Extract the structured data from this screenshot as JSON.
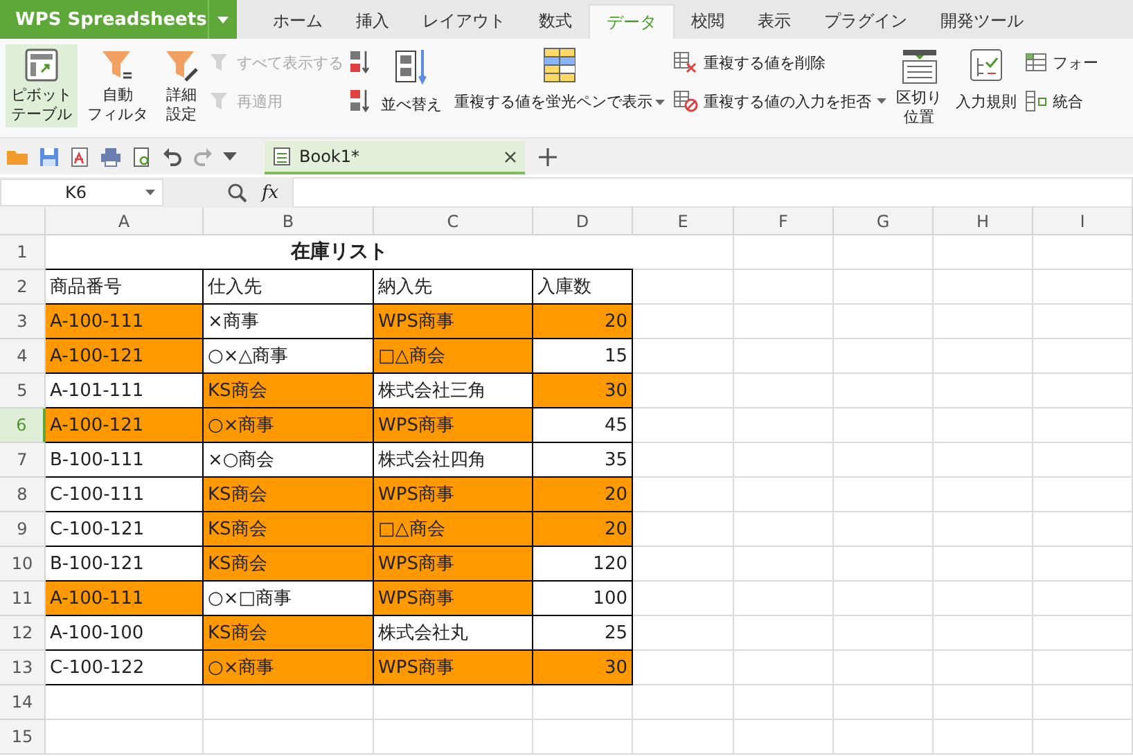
{
  "app": {
    "name": "WPS Spreadsheets"
  },
  "ribbon_tabs": [
    {
      "label": "ホーム",
      "selected": false
    },
    {
      "label": "挿入",
      "selected": false
    },
    {
      "label": "レイアウト",
      "selected": false
    },
    {
      "label": "数式",
      "selected": false
    },
    {
      "label": "データ",
      "selected": true
    },
    {
      "label": "校閲",
      "selected": false
    },
    {
      "label": "表示",
      "selected": false
    },
    {
      "label": "プラグイン",
      "selected": false
    },
    {
      "label": "開発ツール",
      "selected": false
    }
  ],
  "ribbon": [
    {
      "kind": "large",
      "lines": [
        "ピボット",
        "テーブル"
      ],
      "selected": true
    },
    {
      "kind": "large",
      "lines": [
        "自動",
        "フィルタ"
      ],
      "selected": false
    },
    {
      "kind": "large",
      "lines": [
        "詳細",
        "設定"
      ],
      "selected": false
    },
    {
      "kind": "stack",
      "items": [
        {
          "label": "すべて表示する",
          "disabled": true
        },
        {
          "label": "再適用",
          "disabled": true
        }
      ]
    },
    {
      "kind": "stack",
      "items": [
        {
          "disabled": false
        },
        {
          "disabled": false
        }
      ]
    },
    {
      "kind": "medium",
      "label": "並べ替え",
      "dropdown": false
    },
    {
      "kind": "medium",
      "label": "重複する値を蛍光ペンで表示",
      "dropdown": true
    },
    {
      "kind": "stack",
      "items": [
        {
          "label": "重複する値を削除",
          "disabled": false,
          "dropdown": false
        },
        {
          "label": "重複する値の入力を拒否",
          "disabled": false,
          "dropdown": true
        }
      ]
    },
    {
      "kind": "large",
      "lines": [
        "区切り",
        "位置"
      ],
      "selected": false
    },
    {
      "kind": "medium",
      "label": "入力規則",
      "dropdown": false
    },
    {
      "kind": "stack",
      "items": [
        {
          "label": "フォー",
          "disabled": false
        },
        {
          "label": "統合",
          "disabled": false
        }
      ]
    }
  ],
  "document_tabs": [
    {
      "title": "Book1*",
      "selected": true
    }
  ],
  "formula_bar": {
    "name_box": "K6",
    "fx": "fx"
  },
  "columns": [
    "A",
    "B",
    "C",
    "D",
    "E",
    "F",
    "G",
    "H",
    "I"
  ],
  "rows": [
    {
      "number": "1",
      "selected": false,
      "title": "在庫リスト"
    },
    {
      "number": "2",
      "selected": false,
      "cells": [
        {
          "text": "商品番号",
          "kind": "text",
          "highlighted": false
        },
        {
          "text": "仕入先",
          "kind": "text",
          "highlighted": false
        },
        {
          "text": "納入先",
          "kind": "text",
          "highlighted": false
        },
        {
          "text": "入庫数",
          "kind": "text",
          "highlighted": false
        }
      ]
    },
    {
      "number": "3",
      "selected": false,
      "cells": [
        {
          "text": "A-100-111",
          "kind": "text",
          "highlighted": true
        },
        {
          "text": "×商事",
          "kind": "text",
          "highlighted": false
        },
        {
          "text": "WPS商事",
          "kind": "text",
          "highlighted": true
        },
        {
          "text": "20",
          "kind": "number",
          "highlighted": true
        }
      ]
    },
    {
      "number": "4",
      "selected": false,
      "cells": [
        {
          "text": "A-100-121",
          "kind": "text",
          "highlighted": true
        },
        {
          "text": "○×△商事",
          "kind": "text",
          "highlighted": false
        },
        {
          "text": "□△商会",
          "kind": "text",
          "highlighted": true
        },
        {
          "text": "15",
          "kind": "number",
          "highlighted": false
        }
      ]
    },
    {
      "number": "5",
      "selected": false,
      "cells": [
        {
          "text": "A-101-111",
          "kind": "text",
          "highlighted": false
        },
        {
          "text": "KS商会",
          "kind": "text",
          "highlighted": true
        },
        {
          "text": "株式会社三角",
          "kind": "text",
          "highlighted": false
        },
        {
          "text": "30",
          "kind": "number",
          "highlighted": true
        }
      ]
    },
    {
      "number": "6",
      "selected": true,
      "cells": [
        {
          "text": "A-100-121",
          "kind": "text",
          "highlighted": true
        },
        {
          "text": "○×商事",
          "kind": "text",
          "highlighted": true
        },
        {
          "text": "WPS商事",
          "kind": "text",
          "highlighted": true
        },
        {
          "text": "45",
          "kind": "number",
          "highlighted": false
        }
      ]
    },
    {
      "number": "7",
      "selected": false,
      "cells": [
        {
          "text": "B-100-111",
          "kind": "text",
          "highlighted": false
        },
        {
          "text": "×○商会",
          "kind": "text",
          "highlighted": false
        },
        {
          "text": "株式会社四角",
          "kind": "text",
          "highlighted": false
        },
        {
          "text": "35",
          "kind": "number",
          "highlighted": false
        }
      ]
    },
    {
      "number": "8",
      "selected": false,
      "cells": [
        {
          "text": "C-100-111",
          "kind": "text",
          "highlighted": false
        },
        {
          "text": "KS商会",
          "kind": "text",
          "highlighted": true
        },
        {
          "text": "WPS商事",
          "kind": "text",
          "highlighted": true
        },
        {
          "text": "20",
          "kind": "number",
          "highlighted": true
        }
      ]
    },
    {
      "number": "9",
      "selected": false,
      "cells": [
        {
          "text": "C-100-121",
          "kind": "text",
          "highlighted": false
        },
        {
          "text": "KS商会",
          "kind": "text",
          "highlighted": true
        },
        {
          "text": "□△商会",
          "kind": "text",
          "highlighted": true
        },
        {
          "text": "20",
          "kind": "number",
          "highlighted": true
        }
      ]
    },
    {
      "number": "10",
      "selected": false,
      "cells": [
        {
          "text": "B-100-121",
          "kind": "text",
          "highlighted": false
        },
        {
          "text": "KS商会",
          "kind": "text",
          "highlighted": true
        },
        {
          "text": "WPS商事",
          "kind": "text",
          "highlighted": true
        },
        {
          "text": "120",
          "kind": "number",
          "highlighted": false
        }
      ]
    },
    {
      "number": "11",
      "selected": false,
      "cells": [
        {
          "text": "A-100-111",
          "kind": "text",
          "highlighted": true
        },
        {
          "text": "○×□商事",
          "kind": "text",
          "highlighted": false
        },
        {
          "text": "WPS商事",
          "kind": "text",
          "highlighted": true
        },
        {
          "text": "100",
          "kind": "number",
          "highlighted": false
        }
      ]
    },
    {
      "number": "12",
      "selected": false,
      "cells": [
        {
          "text": "A-100-100",
          "kind": "text",
          "highlighted": false
        },
        {
          "text": "KS商会",
          "kind": "text",
          "highlighted": true
        },
        {
          "text": "株式会社丸",
          "kind": "text",
          "highlighted": false
        },
        {
          "text": "25",
          "kind": "number",
          "highlighted": false
        }
      ]
    },
    {
      "number": "13",
      "selected": false,
      "cells": [
        {
          "text": "C-100-122",
          "kind": "text",
          "highlighted": false
        },
        {
          "text": "○×商事",
          "kind": "text",
          "highlighted": true
        },
        {
          "text": "WPS商事",
          "kind": "text",
          "highlighted": true
        },
        {
          "text": "30",
          "kind": "number",
          "highlighted": true
        }
      ]
    },
    {
      "number": "14",
      "selected": false
    },
    {
      "number": "15",
      "selected": false
    }
  ]
}
